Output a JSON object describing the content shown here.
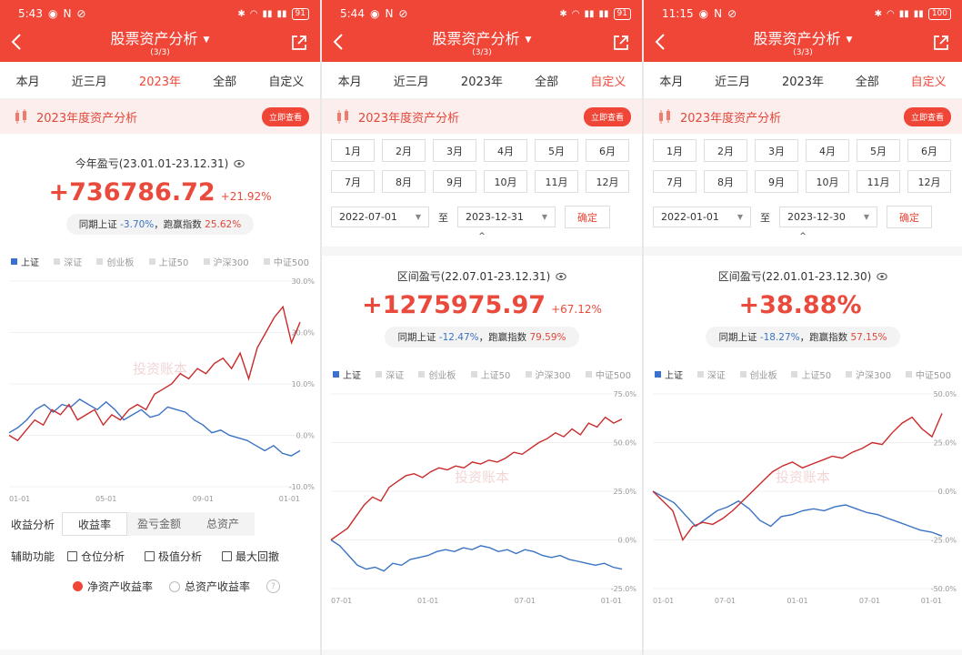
{
  "header": {
    "title": "股票资产分析",
    "sub": "(3/3)"
  },
  "colors": {
    "accent": "#ef4637",
    "red_line": "#c92a2a",
    "blue_line": "#3b73c4"
  },
  "legend": [
    "上证",
    "深证",
    "创业板",
    "上证50",
    "沪深300",
    "中证500"
  ],
  "months": [
    "1月",
    "2月",
    "3月",
    "4月",
    "5月",
    "6月",
    "7月",
    "8月",
    "9月",
    "10月",
    "11月",
    "12月"
  ],
  "panels": [
    {
      "status": {
        "time": "5:43",
        "battery": "91"
      },
      "tabs": [
        "本月",
        "近三月",
        "2023年",
        "全部",
        "自定义"
      ],
      "active_tab": 2,
      "banner": {
        "title": "2023年度资产分析",
        "button": "立即查看"
      },
      "profit": {
        "label": "今年盈亏(23.01.01-23.12.31)",
        "value": "+736786.72",
        "pct": "+21.92%",
        "cmp_prefix": "同期上证",
        "cmp_index": "-3.70%",
        "cmp_mid": "，跑赢指数",
        "cmp_beat": "25.62%"
      },
      "options": {
        "label1": "收益分析",
        "seg": [
          "收益率",
          "盈亏金额",
          "总资产"
        ],
        "label2": "辅助功能",
        "checks": [
          "仓位分析",
          "极值分析",
          "最大回撤"
        ],
        "radio_on": "净资产收益率",
        "radio_off": "总资产收益率",
        "help": "?"
      }
    },
    {
      "status": {
        "time": "5:44",
        "battery": "91"
      },
      "tabs": [
        "本月",
        "近三月",
        "2023年",
        "全部",
        "自定义"
      ],
      "active_tab": 4,
      "banner": {
        "title": "2023年度资产分析",
        "button": "立即查看"
      },
      "range": {
        "from": "2022-07-01",
        "to_label": "至",
        "to": "2023-12-31",
        "ok": "确定"
      },
      "profit": {
        "label": "区间盈亏(22.07.01-23.12.31)",
        "value": "+1275975.97",
        "pct": "+67.12%",
        "cmp_prefix": "同期上证",
        "cmp_index": "-12.47%",
        "cmp_mid": "，跑赢指数",
        "cmp_beat": "79.59%"
      }
    },
    {
      "status": {
        "time": "11:15",
        "battery": "100"
      },
      "tabs": [
        "本月",
        "近三月",
        "2023年",
        "全部",
        "自定义"
      ],
      "active_tab": 4,
      "banner": {
        "title": "2023年度资产分析",
        "button": "立即查看"
      },
      "range": {
        "from": "2022-01-01",
        "to_label": "至",
        "to": "2023-12-30",
        "ok": "确定"
      },
      "profit": {
        "label": "区间盈亏(22.01.01-23.12.30)",
        "value": "+38.88%",
        "pct": "",
        "cmp_prefix": "同期上证",
        "cmp_index": "-18.27%",
        "cmp_mid": "，跑赢指数",
        "cmp_beat": "57.15%"
      }
    }
  ],
  "chart_data": [
    {
      "type": "line",
      "x_ticks": [
        "01-01",
        "05-01",
        "09-01",
        "01-01"
      ],
      "y_ticks": [
        "30.0%",
        "20.0%",
        "10.0%",
        "0.0%",
        "-10.0%"
      ],
      "ylim": [
        -10,
        30
      ],
      "series": [
        {
          "name": "上证",
          "color": "#3b73c4",
          "values": [
            0.5,
            1.5,
            3,
            5,
            6,
            4.5,
            6,
            5.5,
            7,
            6,
            5,
            6.5,
            5,
            3,
            4,
            5,
            3.5,
            4,
            5.5,
            5,
            4.5,
            3,
            2,
            0.5,
            1,
            0,
            -0.5,
            -1,
            -2,
            -3,
            -2,
            -3.5,
            -4,
            -3
          ]
        },
        {
          "name": "",
          "color": "#c92a2a",
          "values": [
            0,
            -1,
            1,
            3,
            2,
            5,
            4,
            6,
            3,
            4,
            5,
            2,
            4,
            3,
            5,
            6,
            5,
            8,
            9,
            10,
            12,
            11,
            13,
            12,
            14,
            15,
            13,
            16,
            11,
            17,
            20,
            23,
            25,
            18,
            22
          ]
        }
      ]
    },
    {
      "type": "line",
      "x_ticks": [
        "07-01",
        "01-01",
        "07-01",
        "01-01"
      ],
      "y_ticks": [
        "75.0%",
        "50.0%",
        "25.0%",
        "0.0%",
        "-25.0%"
      ],
      "ylim": [
        -25,
        75
      ],
      "series": [
        {
          "name": "上证",
          "color": "#3b73c4",
          "values": [
            0,
            -3,
            -8,
            -13,
            -15,
            -14,
            -16,
            -12,
            -13,
            -10,
            -9,
            -8,
            -6,
            -5,
            -6,
            -4,
            -5,
            -3,
            -4,
            -6,
            -5,
            -7,
            -5,
            -6,
            -8,
            -9,
            -8,
            -10,
            -11,
            -12,
            -13,
            -12,
            -14,
            -15
          ]
        },
        {
          "name": "",
          "color": "#c92a2a",
          "values": [
            0,
            3,
            6,
            12,
            18,
            22,
            20,
            27,
            30,
            33,
            34,
            32,
            35,
            37,
            36,
            38,
            37,
            40,
            39,
            41,
            40,
            42,
            45,
            44,
            47,
            50,
            52,
            55,
            53,
            57,
            54,
            60,
            58,
            63,
            60,
            62
          ]
        }
      ]
    },
    {
      "type": "line",
      "x_ticks": [
        "01-01",
        "07-01",
        "01-01",
        "07-01",
        "01-01"
      ],
      "y_ticks": [
        "50.0%",
        "25.0%",
        "0.0%",
        "-25.0%",
        "-50.0%"
      ],
      "ylim": [
        -50,
        50
      ],
      "series": [
        {
          "name": "上证",
          "color": "#3b73c4",
          "values": [
            0,
            -3,
            -6,
            -12,
            -18,
            -14,
            -10,
            -8,
            -5,
            -9,
            -15,
            -18,
            -13,
            -12,
            -10,
            -9,
            -10,
            -8,
            -7,
            -9,
            -11,
            -12,
            -14,
            -16,
            -18,
            -20,
            -21,
            -23
          ]
        },
        {
          "name": "",
          "color": "#c92a2a",
          "values": [
            0,
            -5,
            -10,
            -25,
            -18,
            -16,
            -17,
            -14,
            -10,
            -5,
            0,
            5,
            10,
            13,
            15,
            12,
            14,
            16,
            18,
            17,
            20,
            22,
            25,
            24,
            30,
            35,
            38,
            32,
            28,
            40
          ]
        }
      ]
    }
  ]
}
